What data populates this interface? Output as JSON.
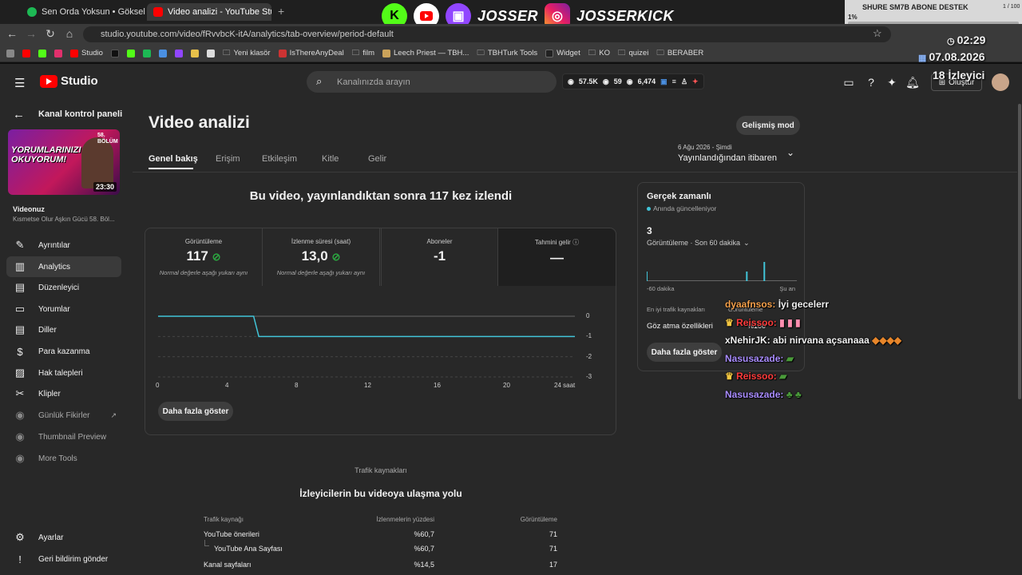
{
  "browser": {
    "tabs": [
      {
        "title": "Sen Orda Yoksun • Göksel",
        "fav": "#1db954"
      },
      {
        "title": "Video analizi - YouTube Studio",
        "fav": "#ff0000"
      }
    ],
    "new_tab": "+",
    "url": "studio.youtube.com/video/fRvvbcK-itA/analytics/tab-overview/period-default",
    "bookmarks": [
      "Studio",
      "Yeni klasör",
      "IsThereAnyDeal",
      "film",
      "Leech Priest — TBH...",
      "TBHTurk Tools",
      "Widget",
      "KO",
      "quizei",
      "BERABER"
    ]
  },
  "overlay": {
    "brand1": "JOSSER",
    "brand2": "JOSSERKICK",
    "mic_title": "SHURE SM7B ABONE DESTEK",
    "mic_pct": "1%",
    "mic_count": "1 / 100",
    "clock": "02:29",
    "date": "07.08.2026",
    "viewers": "18 İzleyici"
  },
  "header": {
    "brand": "Studio",
    "search_placeholder": "Kanalınızda arayın",
    "stat1": "57.5K",
    "stat2": "59",
    "stat3": "6,474",
    "create": "Oluştur"
  },
  "sidebar": {
    "back_label": "Kanal kontrol paneli",
    "thumb_title": "YORUMLARINIZI OKUYORUM!",
    "thumb_badge": "58. BÖLÜM",
    "thumb_duration": "23:30",
    "video_label": "Videonuz",
    "video_title": "Kısmetse Olur Aşkın Gücü 58. Böl...",
    "items": [
      {
        "label": "Ayrıntılar",
        "icon": "pencil-icon"
      },
      {
        "label": "Analytics",
        "icon": "analytics-icon"
      },
      {
        "label": "Düzenleyici",
        "icon": "editor-icon"
      },
      {
        "label": "Yorumlar",
        "icon": "comments-icon"
      },
      {
        "label": "Diller",
        "icon": "subtitles-icon"
      },
      {
        "label": "Para kazanma",
        "icon": "dollar-icon"
      },
      {
        "label": "Hak talepleri",
        "icon": "copyright-icon"
      },
      {
        "label": "Klipler",
        "icon": "scissors-icon"
      },
      {
        "label": "Günlük Fikirler",
        "icon": "extension-icon"
      },
      {
        "label": "Thumbnail Preview",
        "icon": "extension-icon"
      },
      {
        "label": "More Tools",
        "icon": "extension-icon"
      }
    ],
    "settings": "Ayarlar",
    "feedback": "Geri bildirim gönder"
  },
  "main": {
    "title": "Video analizi",
    "advanced_mode": "Gelişmiş mod",
    "tabs": [
      "Genel bakış",
      "Erişim",
      "Etkileşim",
      "Kitle",
      "Gelir"
    ],
    "period_date": "6 Ağu 2026 - Şimdi",
    "period_label": "Yayınlandığından itibaren",
    "headline": "Bu video, yayınlandıktan sonra 117 kez izlendi",
    "metrics": [
      {
        "label": "Görüntüleme",
        "value": "117",
        "note": "Normal değerle aşağı yukarı aynı"
      },
      {
        "label": "İzlenme süresi (saat)",
        "value": "13,0",
        "note": "Normal değerle aşağı yukarı aynı"
      },
      {
        "label": "Aboneler",
        "value": "-1",
        "note": ""
      },
      {
        "label": "Tahmini gelir",
        "value": "—",
        "note": ""
      }
    ],
    "show_more": "Daha fazla göster",
    "traffic_small": "Trafik kaynakları",
    "traffic_title": "İzleyicilerin bu videoya ulaşma yolu",
    "traffic_headers": [
      "Trafik kaynağı",
      "İzlenmelerin yüzdesi",
      "Görüntüleme"
    ],
    "traffic_rows": [
      {
        "source": "YouTube önerileri",
        "pct": "%60,7",
        "views": "71"
      },
      {
        "source": "YouTube Ana Sayfası",
        "pct": "%60,7",
        "views": "71"
      },
      {
        "source": "Kanal sayfaları",
        "pct": "%14,5",
        "views": "17"
      }
    ]
  },
  "realtime": {
    "title": "Gerçek zamanlı",
    "subtitle": "Anında güncelleniyor",
    "value": "3",
    "metric": "Görüntüleme · Son 60 dakika",
    "axis_left": "-60 dakika",
    "axis_right": "Şu an",
    "top_sources": "En iyi trafik kaynakları",
    "views_col": "Görüntüleme",
    "source": "Göz atma özellikleri",
    "source_val": "%100",
    "show_more": "Daha fazla göster"
  },
  "chat": [
    {
      "user": "dyaafnsos:",
      "msg": "İyi gecelerr",
      "color": "#f5a04a"
    },
    {
      "user": "Reissoo:",
      "msg": "",
      "color": "#ff3b3b"
    },
    {
      "user": "xNehirJK:",
      "msg": "abi nirvana açsanaaa",
      "color": "#ffffff"
    },
    {
      "user": "Nasusazade:",
      "msg": "",
      "color": "#a98cff"
    },
    {
      "user": "Reissoo:",
      "msg": "",
      "color": "#ff3b3b"
    },
    {
      "user": "Nasusazade:",
      "msg": "",
      "color": "#a98cff"
    }
  ],
  "chart_data": [
    {
      "type": "line",
      "title": "",
      "x": [
        0,
        5.5,
        5.8,
        6,
        24
      ],
      "series": [
        {
          "values": [
            0,
            0,
            -1,
            -1,
            -1
          ]
        }
      ],
      "xticks": [
        "0",
        "4",
        "8",
        "12",
        "16",
        "20",
        "24 saat"
      ],
      "yticks": [
        "0",
        "-1",
        "-2",
        "-3"
      ],
      "xlim": [
        0,
        24
      ],
      "ylim": [
        -3,
        0
      ],
      "color": "#41c4d8"
    },
    {
      "type": "bar",
      "title": "",
      "x": [
        -60,
        -20,
        -13
      ],
      "values": [
        1,
        1,
        2
      ],
      "xlabel_left": "-60 dakika",
      "xlabel_right": "Şu an",
      "color": "#41c4d8"
    }
  ]
}
